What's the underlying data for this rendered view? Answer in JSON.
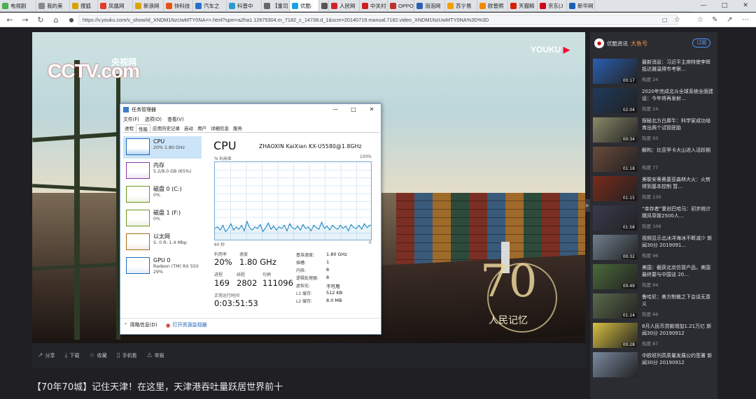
{
  "browser": {
    "tabs": [
      {
        "label": "电视剧",
        "color": "#4caf50"
      },
      {
        "label": "我的美",
        "color": "#888888"
      },
      {
        "label": "搜狐",
        "color": "#d8a200"
      },
      {
        "label": "凤凰网",
        "color": "#e23b2a"
      },
      {
        "label": "新浪网",
        "color": "#e0a000"
      },
      {
        "label": "快科技",
        "color": "#e8501a"
      },
      {
        "label": "汽车之",
        "color": "#2a71c9"
      },
      {
        "label": "科普中",
        "color": "#2a9ad6"
      },
      {
        "label": "【重司",
        "color": "#666666"
      },
      {
        "label": "优酷·",
        "color": "#1aa1e5"
      },
      {
        "label": "【",
        "color": "#555555"
      },
      {
        "label": "人民网",
        "color": "#d1232a"
      },
      {
        "label": "中关村",
        "color": "#cc2020"
      },
      {
        "label": "OPPO",
        "color": "#c03030"
      },
      {
        "label": "泡泡网",
        "color": "#2b5fb8"
      },
      {
        "label": "苏宁易",
        "color": "#f0a000"
      },
      {
        "label": "欧普照",
        "color": "#f08a00"
      },
      {
        "label": "天猫精",
        "color": "#d81e06"
      },
      {
        "label": "京东(J",
        "color": "#d0021b"
      },
      {
        "label": "新华网",
        "color": "#1a5fb4"
      }
    ],
    "window_controls": [
      "—",
      "□",
      "✕"
    ],
    "url": "https://v.youku.com/v_show/id_XNDM1NzUwMTY0NA==.html?spm=a2ha1.12675304.m_7182_c_14738.d_1&scm=20140719.manual.7182.video_XNDM1NzUwMTY0NA%3D%3D"
  },
  "video": {
    "logo_cctv": "CCTV.com",
    "logo_cctv_cn": "央视网",
    "logo_youku": "YOUKU",
    "badge_number": "70",
    "badge_text": "人民记忆"
  },
  "video_controls": [
    {
      "icon": "share-icon",
      "label": "分享"
    },
    {
      "icon": "download-icon",
      "label": "下载"
    },
    {
      "icon": "favorite-icon",
      "label": "收藏"
    },
    {
      "icon": "phone-icon",
      "label": "手机看"
    },
    {
      "icon": "report-icon",
      "label": "举报"
    }
  ],
  "page_title": "【70年70城】记住天津！在这里，天津港吞吐量跃居世界前十",
  "sidebar": {
    "channel": "优酷资讯",
    "tag": "大鱼号",
    "subscribe": "订阅",
    "items": [
      {
        "title": "最新消息：习近平主席特使李辉抵达雅温得市考察…",
        "dur": "00:17",
        "heat": "热度 24",
        "bg": "#2a5fb0"
      },
      {
        "title": "2020年完成北斗全球系统全面建设：今年将再发射…",
        "dur": "02:04",
        "heat": "热度 24",
        "bg": "#1d3a5c"
      },
      {
        "title": "探秘北方白犀牛：科学家成功培育出两个试管胚胎",
        "dur": "00:34",
        "heat": "热度 93",
        "bg": "#8a8a6a"
      },
      {
        "title": "解构：比亚甲卡大山进入活跃期",
        "dur": "01:18",
        "heat": "热度 77",
        "bg": "#6a4a3a"
      },
      {
        "title": "美联安蒂奥基亚森林大火：火势得到基本控制 暂…",
        "dur": "01:15",
        "heat": "热度 130",
        "bg": "#7a2a1a"
      },
      {
        "title": "“幸存者”重创巴哈马：初步统计 飓风导致2500人…",
        "dur": "01:58",
        "heat": "热度 106",
        "bg": "#3a3a50"
      },
      {
        "title": "视频显示北冰洋海冰不断减少 新闻30分 2019091…",
        "dur": "00:32",
        "heat": "热度 96",
        "bg": "#6f7f8f"
      },
      {
        "title": "美国：截获北京仿冒产品，美国最终要与中国谈 20…",
        "dur": "00:49",
        "heat": "热度 94",
        "bg": "#4a6a3a"
      },
      {
        "title": "鲁哈尼：美方制裁之下会谈无意义",
        "dur": "01:14",
        "heat": "热度 66",
        "bg": "#5a6a4a"
      },
      {
        "title": "8月人民币贷款增加1.21万亿 新闻30分 20190912",
        "dur": "00:28",
        "heat": "热度 87",
        "bg": "#d8c040"
      },
      {
        "title": "中欧班列高质量发展公约签署 新闻30分 20190912",
        "dur": "",
        "heat": "",
        "bg": "#7a8aa0"
      }
    ]
  },
  "taskmanager": {
    "title": "任务管理器",
    "menu": [
      "文件(F)",
      "选项(O)",
      "查看(V)"
    ],
    "tabs": [
      "进程",
      "性能",
      "应用历史记录",
      "启动",
      "用户",
      "详细信息",
      "服务"
    ],
    "selected_tab": 1,
    "side": [
      {
        "name": "CPU",
        "sub": "20% 1.80 GHz",
        "color": "#1c6fbf"
      },
      {
        "name": "内存",
        "sub": "5.2/8.0 GB (65%)",
        "color": "#8a3aa8"
      },
      {
        "name": "磁盘 0 (C:)",
        "sub": "0%",
        "color": "#6a9a1a"
      },
      {
        "name": "磁盘 1 (F:)",
        "sub": "0%",
        "color": "#6a9a1a"
      },
      {
        "name": "以太网",
        "sub": "S: 0 R: 1.4 Mbp",
        "color": "#a86a1a"
      },
      {
        "name": "GPU 0",
        "sub": "Radeon (TM) RX 550",
        "sub2": "29%",
        "color": "#1c6fbf"
      }
    ],
    "cpu_title": "CPU",
    "cpu_name": "ZHAOXIN KaiXian KX-U5580@1.8GHz",
    "util_label": "% 利用率",
    "pct_label": "100%",
    "time_label": "60 秒",
    "zero_label": "0",
    "utilization_series": [
      0.16,
      0.18,
      0.14,
      0.2,
      0.12,
      0.16,
      0.22,
      0.14,
      0.18,
      0.15,
      0.2,
      0.13,
      0.25,
      0.17,
      0.14,
      0.18,
      0.16,
      0.21,
      0.12,
      0.17,
      0.23,
      0.15,
      0.19,
      0.14,
      0.18,
      0.16,
      0.2,
      0.13,
      0.22,
      0.17,
      0.15,
      0.19,
      0.14,
      0.21,
      0.16,
      0.18,
      0.13,
      0.2,
      0.17,
      0.15,
      0.24,
      0.16,
      0.19,
      0.14,
      0.2,
      0.17,
      0.15,
      0.2,
      0.16,
      0.19,
      0.13,
      0.21,
      0.17,
      0.16,
      0.2,
      0.15,
      0.22,
      0.17,
      0.2,
      0.2
    ],
    "stats": {
      "util_l": "利用率",
      "util_v": "20%",
      "speed_l": "速度",
      "speed_v": "1.80 GHz",
      "proc_l": "进程",
      "proc_v": "169",
      "thr_l": "线程",
      "thr_v": "2802",
      "hdl_l": "句柄",
      "hdl_v": "111096",
      "up_l": "正常运行时间",
      "up_v": "0:03:51:53"
    },
    "kv": [
      {
        "k": "基准速度:",
        "v": "1.80 GHz"
      },
      {
        "k": "插槽:",
        "v": "1"
      },
      {
        "k": "内核:",
        "v": "8"
      },
      {
        "k": "逻辑处理器:",
        "v": "8"
      },
      {
        "k": "虚拟化:",
        "v": "不可用"
      },
      {
        "k": "L1 缓存:",
        "v": "512 KB"
      },
      {
        "k": "L2 缓存:",
        "v": "8.0 MB"
      }
    ],
    "footer_left": "简略信息(D)",
    "footer_link": "打开资源监视器"
  }
}
